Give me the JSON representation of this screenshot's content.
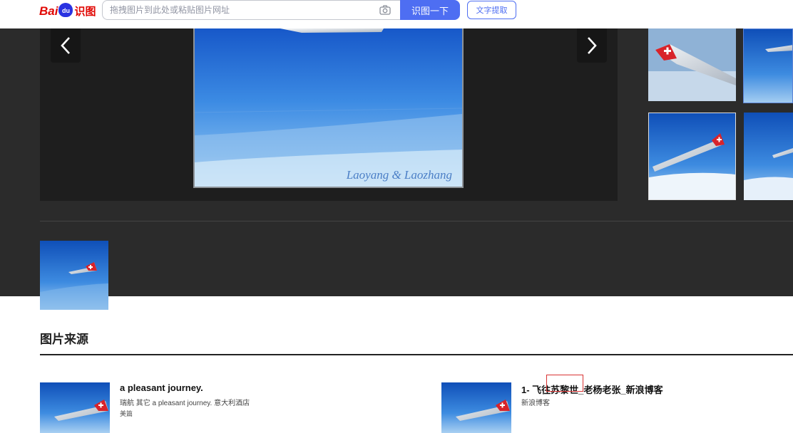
{
  "header": {
    "logo_bai": "Bai",
    "logo_du": "du",
    "logo_shitu": "识图",
    "search_placeholder": "拖拽图片到此处或粘贴图片网址",
    "search_button": "识图一下",
    "ocr_button": "文字提取"
  },
  "viewer": {
    "caption": "Laoyang & Laozhang"
  },
  "source": {
    "title": "图片来源",
    "results": [
      {
        "title": "a pleasant journey.",
        "desc": "瑞航 其它 a pleasant journey. 意大利酒店",
        "site": "美篇"
      },
      {
        "title": "1- 飞往苏黎世_老杨老张_新浪博客",
        "desc": "新浪博客",
        "site": ""
      }
    ]
  },
  "colors": {
    "accent": "#4e6ef2",
    "brand_red": "#e10602",
    "dark_bg": "#2b2b2b",
    "viewer_bg": "#1e1e1e"
  }
}
